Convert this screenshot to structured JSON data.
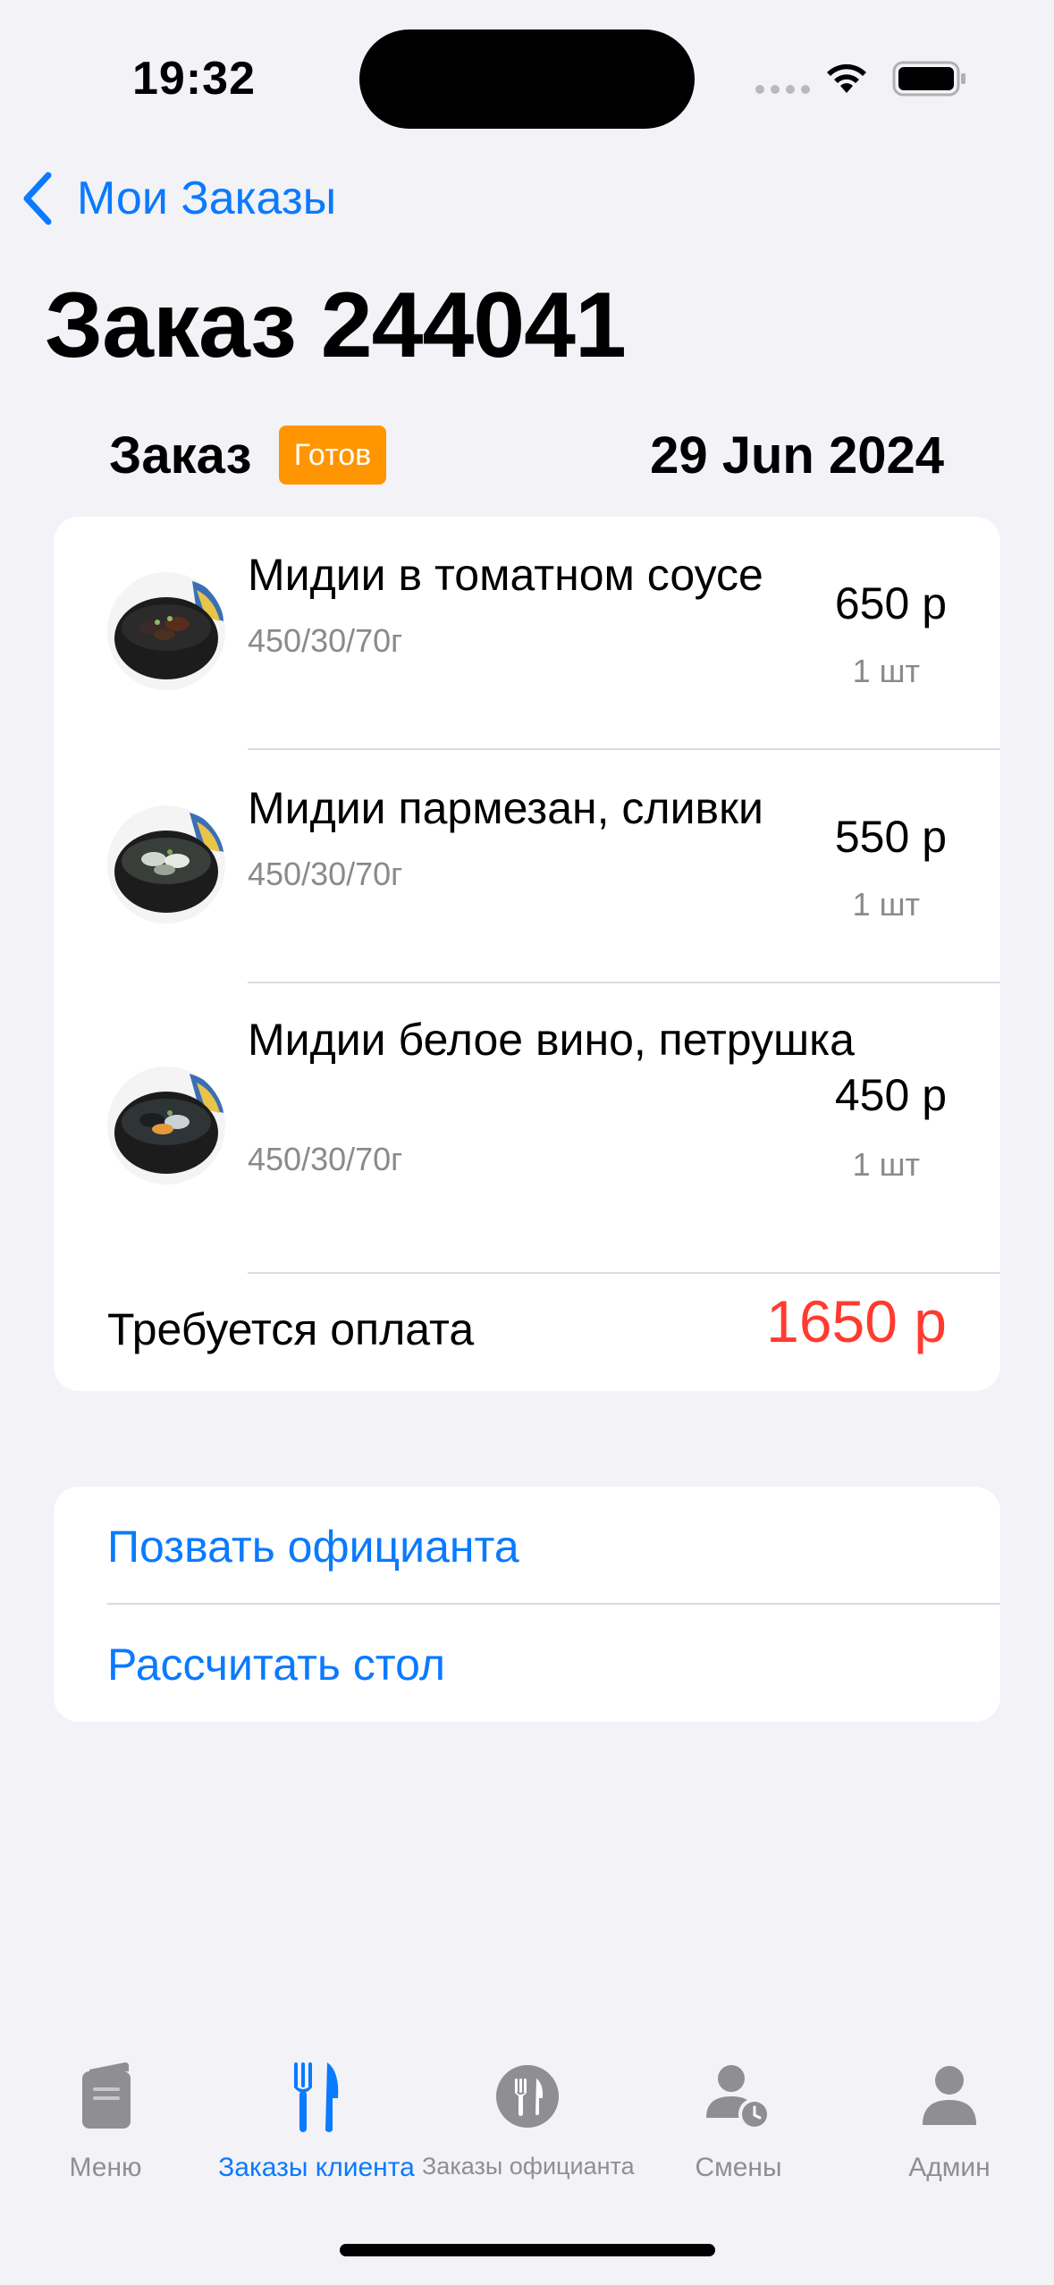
{
  "status_bar": {
    "time": "19:32"
  },
  "nav": {
    "back_label": "Мои Заказы",
    "title": "Заказ 244041"
  },
  "order": {
    "label": "Заказ",
    "status": "Готов",
    "date": "29 Jun 2024"
  },
  "items": [
    {
      "name": "Мидии в томатном соусе",
      "weight": "450/30/70г",
      "price": "650 р",
      "qty": "1 шт"
    },
    {
      "name": "Мидии пармезан, сливки",
      "weight": "450/30/70г",
      "price": "550 р",
      "qty": "1 шт"
    },
    {
      "name": "Мидии белое вино, петрушка",
      "weight": "450/30/70г",
      "price": "450 р",
      "qty": "1 шт"
    }
  ],
  "total": {
    "label": "Требуется оплата",
    "value": "1650 р"
  },
  "actions": {
    "call_waiter": "Позвать официанта",
    "settle_table": "Рассчитать стол"
  },
  "tabs": [
    {
      "label": "Меню",
      "icon": "menu-book-icon"
    },
    {
      "label": "Заказы клиента",
      "icon": "fork-knife-icon",
      "active": true
    },
    {
      "label": "Заказы официанта",
      "icon": "fork-knife-circle-icon"
    },
    {
      "label": "Смены",
      "icon": "person-clock-icon"
    },
    {
      "label": "Админ",
      "icon": "person-icon"
    }
  ],
  "colors": {
    "accent": "#0A7AFF",
    "badge": "#FF9500",
    "total": "#FF3B30",
    "background": "#F2F2F7"
  }
}
